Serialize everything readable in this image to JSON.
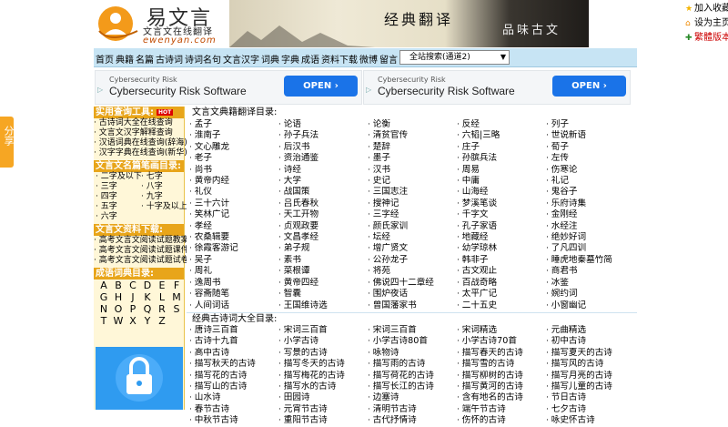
{
  "share_tab": "分享",
  "logo": {
    "name": "易文言",
    "slogan": "文言文在线翻译",
    "domain": "ewenyan.com"
  },
  "banner": {
    "text1": "经典翻译",
    "text2": "品味古文"
  },
  "top_links": {
    "favorite": "加入收藏",
    "homepage": "设为主页",
    "traditional": "繁體版本"
  },
  "nav": {
    "links": [
      "首页",
      "典籍",
      "名篇",
      "古诗词",
      "诗词名句",
      "文言汉字",
      "词典",
      "字典",
      "成语",
      "资料下载",
      "微博",
      "留言"
    ],
    "search_option": "全站搜索(通道2)"
  },
  "ads": [
    {
      "source": "Cybersecurity Risk",
      "title": "Cybersecurity Risk Software",
      "button": "OPEN"
    },
    {
      "source": "Cybersecurity Risk",
      "title": "Cybersecurity Risk Software",
      "button": "OPEN"
    }
  ],
  "sidebar": {
    "tools_head": "实用查询工具:",
    "tools_badge": "HOT",
    "tools": [
      "古诗词大全在线查询",
      "文言文汉字解释查询",
      "汉语词典在线查询(辞海)",
      "汉字字典在线查询(新华)"
    ],
    "strokes_head": "文言文名篇笔画目录:",
    "strokes": [
      "二字及以下",
      "七字",
      "三字",
      "八字",
      "四字",
      "九字",
      "五字",
      "十字及以上",
      "六字"
    ],
    "downloads_head": "文言文资料下载:",
    "downloads": [
      "高考文言文阅读试题教案",
      "高考文言文阅读试题课件",
      "高考文言文阅读试题试卷"
    ],
    "idiom_head": "成语词典目录:",
    "letters": [
      "A",
      "B",
      "C",
      "D",
      "E",
      "F",
      "G",
      "H",
      "J",
      "K",
      "L",
      "M",
      "N",
      "O",
      "P",
      "Q",
      "R",
      "S",
      "T",
      "W",
      "X",
      "Y",
      "Z"
    ]
  },
  "classics": {
    "head": "文言文典籍翻译目录:",
    "items": [
      "孟子",
      "论语",
      "论衡",
      "反经",
      "列子",
      "淮南子",
      "孙子兵法",
      "清贫官传",
      "六韬|三略",
      "世说新语",
      "文心雕龙",
      "后汉书",
      "楚辞",
      "庄子",
      "荀子",
      "老子",
      "资治通鉴",
      "墨子",
      "孙膑兵法",
      "左传",
      "尚书",
      "诗经",
      "汉书",
      "周易",
      "伤寒论",
      "黄帝内经",
      "大学",
      "史记",
      "中庸",
      "礼记",
      "礼仪",
      "战国策",
      "三国志注",
      "山海经",
      "鬼谷子",
      "三十六计",
      "吕氏春秋",
      "搜神记",
      "梦溪笔谈",
      "乐府诗集",
      "笑林广记",
      "天工开物",
      "三字经",
      "千字文",
      "金刚经",
      "孝经",
      "贞观政要",
      "颜氏家训",
      "孔子家语",
      "水经注",
      "农桑辑要",
      "文昌孝经",
      "坛经",
      "地藏经",
      "绝妙好词",
      "徐霞客游记",
      "弟子规",
      "增广贤文",
      "幼学琼林",
      "了凡四训",
      "吴子",
      "素书",
      "公孙龙子",
      "韩非子",
      "睡虎地秦墓竹简",
      "周礼",
      "菜根谭",
      "将苑",
      "古文观止",
      "商君书",
      "逸周书",
      "黄帝四经",
      "佛说四十二章经",
      "百战奇略",
      "冰鉴",
      "容斋随笔",
      "智囊",
      "围炉夜话",
      "太平广记",
      "婉约词",
      "人间词话",
      "王国维诗选",
      "曾国藩家书",
      "二十五史",
      "小窗幽记"
    ]
  },
  "poems": {
    "head": "经典古诗词大全目录:",
    "items": [
      "唐诗三百首",
      "宋词三百首",
      "宋词三百首",
      "宋词精选",
      "元曲精选",
      "古诗十九首",
      "小学古诗",
      "小学古诗80首",
      "小学古诗70首",
      "初中古诗",
      "高中古诗",
      "写景的古诗",
      "咏物诗",
      "描写春天的古诗",
      "描写夏天的古诗",
      "描写秋天的古诗",
      "描写冬天的古诗",
      "描写雨的古诗",
      "描写雪的古诗",
      "描写风的古诗",
      "描写花的古诗",
      "描写梅花的古诗",
      "描写荷花的古诗",
      "描写柳树的古诗",
      "描写月亮的古诗",
      "描写山的古诗",
      "描写水的古诗",
      "描写长江的古诗",
      "描写黄河的古诗",
      "描写儿童的古诗",
      "山水诗",
      "田园诗",
      "边塞诗",
      "含有地名的古诗",
      "节日古诗",
      "春节古诗",
      "元宵节古诗",
      "清明节古诗",
      "端午节古诗",
      "七夕古诗",
      "中秋节古诗",
      "重阳节古诗",
      "古代抒情诗",
      "伤怀的古诗",
      "咏史怀古诗"
    ]
  }
}
